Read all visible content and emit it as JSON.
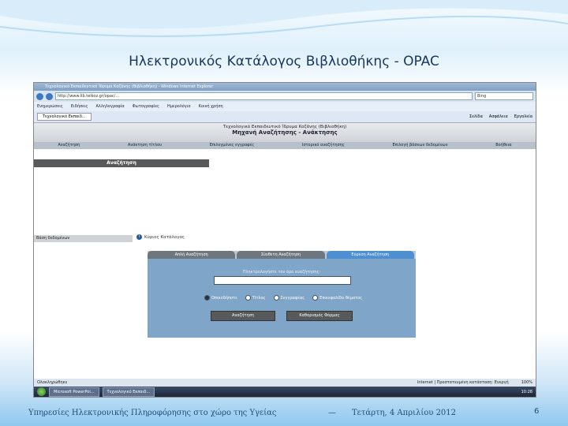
{
  "slide": {
    "title": "Ηλεκτρονικός Κατάλογος Βιβλιοθήκης - OPAC",
    "footer_left": "Υπηρεσίες Ηλεκτρονικής Πληροφόρησης στο χώρο της Υγείας",
    "footer_sep": "—",
    "footer_date": "Τετάρτη, 4 Απριλίου 2012",
    "page_number": "6"
  },
  "browser": {
    "title": "Τεχνολογικό Εκπαιδευτικό Ίδρυμα Κοζάνης (Βιβλιοθήκη) - Windows Internet Explorer",
    "address": "http://www.lib.teikoz.gr/opac/...",
    "search_placeholder": "Bing",
    "links": [
      "Ενημερώσεις",
      "Ειδήσεις",
      "Αλληλογραφία",
      "Φωτογραφίες",
      "Ημερολόγιο",
      "Κοινή χρήση"
    ],
    "tab_label": "Τεχνολογικό Εκπαιδ...",
    "tools": [
      "Σελίδα",
      "Ασφάλεια",
      "Εργαλεία"
    ]
  },
  "library": {
    "header_line1": "Τεχνολογικό Εκπαιδευτικό Ίδρυμα Κοζάνης (Βιβλιοθήκη)",
    "header_line2": "Μηχανή Αναζήτησης - Ανάκτησης",
    "menu": [
      "Αναζήτηση",
      "Ανάκτηση τίτλου",
      "Επιλεγμένες εγγραφές",
      "Ιστορικό αναζήτησης",
      "Επιλογή βάσεων δεδομένων",
      "Βοήθεια"
    ],
    "left_title": "Αναζήτηση",
    "db_label": "Βάση δεδομένων",
    "catalog_label": "Κύριος Κατάλογος",
    "tabs": [
      "Απλή Αναζήτηση",
      "Σύνθετη Αναζήτηση",
      "Εύρεση Αναζήτηση"
    ],
    "query_label": "Πληκτρολογήστε τον όρο αναζήτησης:",
    "radios": [
      "Οποιοδήποτε",
      "Τίτλος",
      "Συγγραφέας",
      "Επικεφαλίδα θέματος"
    ],
    "search_button": "Αναζήτηση",
    "clear_button": "Καθαρισμός Φόρμας"
  },
  "status": {
    "left": "Ολοκληρώθηκε",
    "zone": "Internet | Προστατευμένη κατάσταση: Ενεργή",
    "zoom": "100%"
  },
  "taskbar": {
    "tasks": [
      "Microsoft PowerPoi...",
      "Τεχνολογικό Εκπαιδ..."
    ],
    "time": "10:28"
  }
}
